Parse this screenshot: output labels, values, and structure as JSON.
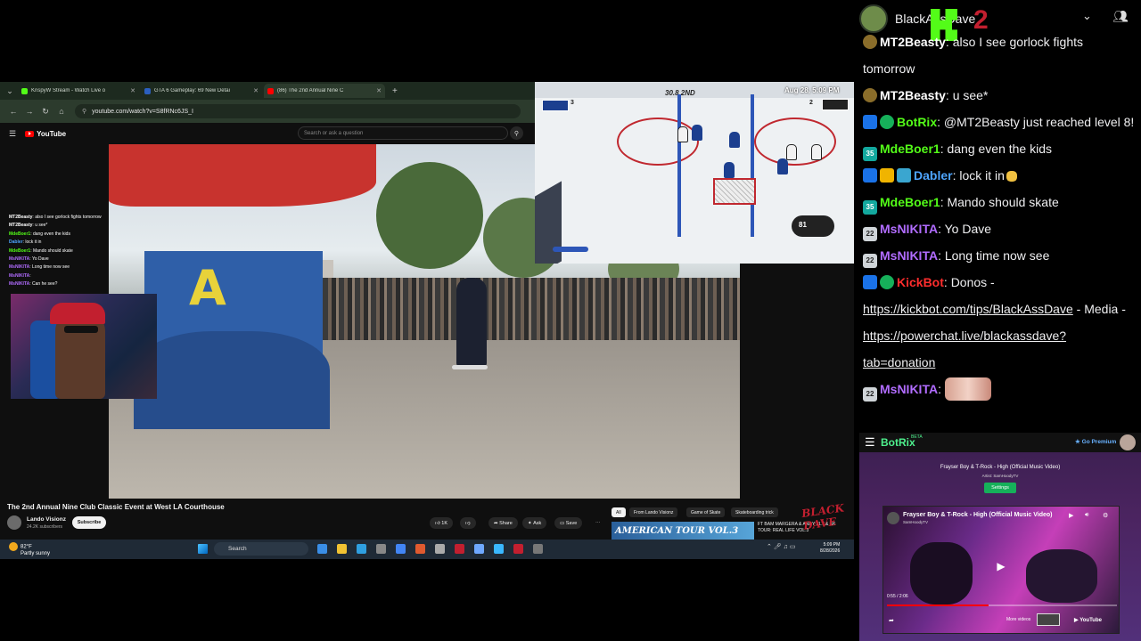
{
  "browser": {
    "tabs": [
      {
        "label": "KrispyW Stream - Watch Live o",
        "color": "#53fc18",
        "active": false
      },
      {
        "label": "GTA 6 Gameplay: 69 New Detai",
        "color": "#2b5fbf",
        "active": false
      },
      {
        "label": "(86) The 2nd Annual Nine C",
        "color": "#ff0000",
        "active": true
      }
    ],
    "url": "youtube.com/watch?v=S8fRNc6JS_I"
  },
  "youtube": {
    "logo": "YouTube",
    "search_placeholder": "Search or ask a question",
    "video_title": "The 2nd Annual Nine Club Classic Event at West LA Courthouse",
    "channel": "Lando Visionz",
    "subscribers": "24.2K subscribers",
    "subscribe_label": "Subscribe",
    "actions": {
      "likes": "1K",
      "share": "Share",
      "ask": "Ask",
      "save": "Save",
      "more": "⋯"
    },
    "chips": [
      "All",
      "From Lando Visionz",
      "Game of Skate",
      "Skateboarding trick"
    ],
    "rec_thumb_text": "AMERICAN TOUR VOL.3",
    "rec_title": "FT BAM MARGERA & ANDY ELY & SK TOUR: REAL LIFE VOL.3",
    "watermark": "BLACK DAVE"
  },
  "overlay_chat": [
    {
      "user": "MT2Beasty",
      "text": "also I see gorlock fights tomorrow",
      "color": "#ffffff"
    },
    {
      "user": "MT2Beasty",
      "text": "u see*",
      "color": "#ffffff"
    },
    {
      "user": "MdeBoer1",
      "text": "dang even the kids",
      "color": "#53fc18"
    },
    {
      "user": "Dabler",
      "text": "lock it in",
      "color": "#4ea5ff"
    },
    {
      "user": "MdeBoer1",
      "text": "Mando should skate",
      "color": "#53fc18"
    },
    {
      "user": "MsNIKITA",
      "text": "Yo Dave",
      "color": "#b16cff"
    },
    {
      "user": "MsNIKITA",
      "text": "Long time now see",
      "color": "#b16cff"
    },
    {
      "user": "MsNIKITA",
      "text": "",
      "color": "#b16cff"
    },
    {
      "user": "MsNIKITA",
      "text": "Can he see?",
      "color": "#b16cff"
    }
  ],
  "game": {
    "score": "30.8   2ND",
    "date": "Aug 28, 5:09 PM",
    "home_goals": "3",
    "away_goals": "2",
    "badge": "81"
  },
  "taskbar": {
    "weather_temp": "82°F",
    "weather_desc": "Partly sunny",
    "search_label": "Search",
    "time": "5:09 PM",
    "date": "8/28/2026"
  },
  "chat": {
    "channel_name": "BlackAssDave",
    "messages": [
      {
        "user": "MT2Beasty",
        "color": "#ffffff",
        "badges": [
          "b-rank"
        ],
        "text": "also I see gorlock fights tomorrow"
      },
      {
        "user": "MT2Beasty",
        "color": "#ffffff",
        "badges": [
          "b-rank"
        ],
        "text": "u see*"
      },
      {
        "user": "BotRix",
        "color": "#53fc18",
        "badges": [
          "b-mod",
          "b-ver"
        ],
        "text": "@MT2Beasty just reached level 8!"
      },
      {
        "user": "MdeBoer1",
        "color": "#53fc18",
        "badges": [
          "b-sub35"
        ],
        "text": "dang even the kids"
      },
      {
        "user": "Dabler",
        "color": "#4ea5ff",
        "badges": [
          "b-mod",
          "b-crown",
          "b-bars"
        ],
        "text": "lock it in"
      },
      {
        "user": "MdeBoer1",
        "color": "#53fc18",
        "badges": [
          "b-sub35"
        ],
        "text": "Mando should skate"
      },
      {
        "user": "MsNIKITA",
        "color": "#b16cff",
        "badges": [
          "b-22"
        ],
        "text": "Yo Dave"
      },
      {
        "user": "MsNIKITA",
        "color": "#b16cff",
        "badges": [
          "b-22"
        ],
        "text": "Long time now see"
      }
    ],
    "kickbot": {
      "user": "KickBot",
      "color": "#ff2d2d",
      "prefix": "Donos - ",
      "link1": "https://kickbot.com/tips/BlackAssDave",
      "mid": " - Media - ",
      "link2": "https://powerchat.live/blackassdave?tab=donation"
    },
    "last": {
      "user": "MsNIKITA",
      "color": "#b16cff"
    },
    "badge_text": {
      "b-sub35": "35",
      "b-22": "22"
    }
  },
  "botrix": {
    "name": "BotRix",
    "beta": "BETA",
    "premium": "Go Premium",
    "now_playing": "Frayser Boy & T-Rock - High (Official Music Video)",
    "artist": "Artist: SamHoodyTV",
    "settings_label": "Settings",
    "embed_title": "Frayser Boy & T-Rock - High (Official Music Video)",
    "embed_channel": "SamHoodyTV",
    "time": "0:55 / 2:06",
    "progress": 0.44,
    "more_videos": "More videos",
    "yt": "YouTube"
  }
}
